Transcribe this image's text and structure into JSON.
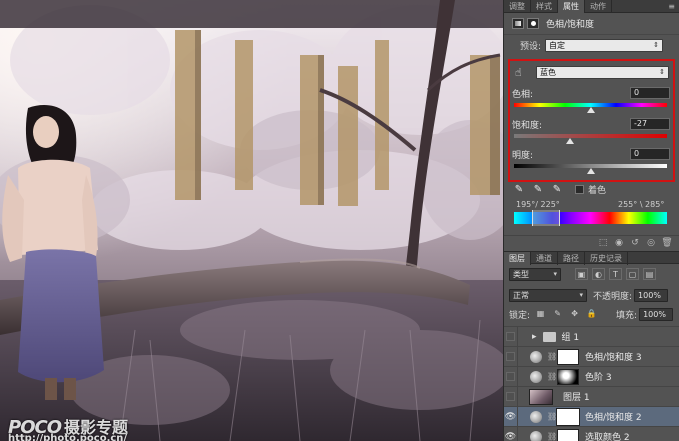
{
  "properties_panel": {
    "tabs": [
      "调整",
      "样式",
      "属性",
      "动作"
    ],
    "active_tab": "属性",
    "title": "色相/饱和度",
    "preset_label": "预设:",
    "preset_value": "自定",
    "channel_value": "蓝色",
    "hue": {
      "label": "色相:",
      "value": "0"
    },
    "saturation": {
      "label": "饱和度:",
      "value": "-27"
    },
    "lightness": {
      "label": "明度:",
      "value": "0"
    },
    "colorize_label": "着色",
    "range_left": "195°/ 225°",
    "range_right": "255° \\ 285°"
  },
  "layers_panel": {
    "tabs": [
      "图层",
      "通道",
      "路径",
      "历史记录"
    ],
    "active_tab": "图层",
    "filter_kind": "类型",
    "blend_mode": "正常",
    "opacity_label": "不透明度:",
    "opacity_value": "100%",
    "lock_label": "锁定:",
    "fill_label": "填充:",
    "fill_value": "100%",
    "layers": [
      {
        "name": "组 1",
        "kind": "group",
        "visible": false,
        "selected": false
      },
      {
        "name": "色相/饱和度 3",
        "kind": "adjustment",
        "visible": false,
        "selected": false
      },
      {
        "name": "色阶 3",
        "kind": "adjustment",
        "visible": false,
        "selected": false
      },
      {
        "name": "图层 1",
        "kind": "pixel",
        "visible": false,
        "selected": false
      },
      {
        "name": "色相/饱和度 2",
        "kind": "adjustment",
        "visible": true,
        "selected": true
      },
      {
        "name": "选取颜色 2",
        "kind": "adjustment",
        "visible": true,
        "selected": false
      }
    ]
  },
  "watermark": {
    "logo": "POCO",
    "name": "摄影专题",
    "url": "http://photo.poco.cn/"
  },
  "colors": {
    "highlight_box": "#d11212",
    "selected_layer": "#5c6a7d",
    "panel_bg": "#535353"
  }
}
